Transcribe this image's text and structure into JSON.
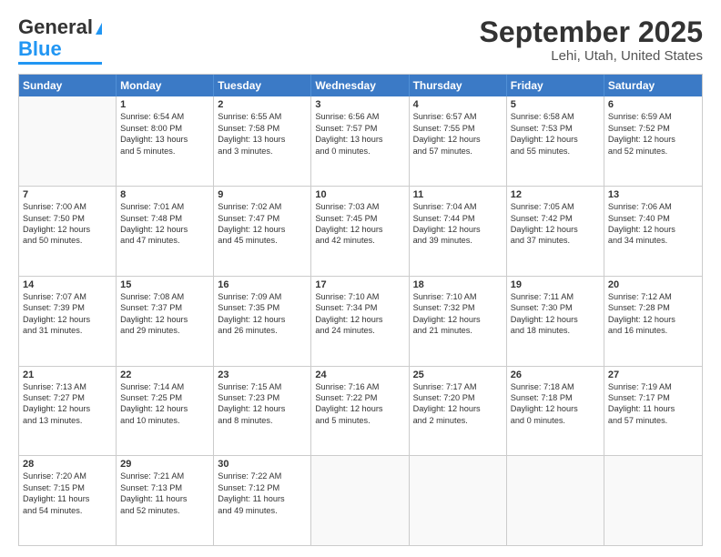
{
  "header": {
    "logo_line1": "General",
    "logo_line2": "Blue",
    "month": "September 2025",
    "location": "Lehi, Utah, United States"
  },
  "weekdays": [
    "Sunday",
    "Monday",
    "Tuesday",
    "Wednesday",
    "Thursday",
    "Friday",
    "Saturday"
  ],
  "rows": [
    [
      {
        "day": "",
        "lines": []
      },
      {
        "day": "1",
        "lines": [
          "Sunrise: 6:54 AM",
          "Sunset: 8:00 PM",
          "Daylight: 13 hours",
          "and 5 minutes."
        ]
      },
      {
        "day": "2",
        "lines": [
          "Sunrise: 6:55 AM",
          "Sunset: 7:58 PM",
          "Daylight: 13 hours",
          "and 3 minutes."
        ]
      },
      {
        "day": "3",
        "lines": [
          "Sunrise: 6:56 AM",
          "Sunset: 7:57 PM",
          "Daylight: 13 hours",
          "and 0 minutes."
        ]
      },
      {
        "day": "4",
        "lines": [
          "Sunrise: 6:57 AM",
          "Sunset: 7:55 PM",
          "Daylight: 12 hours",
          "and 57 minutes."
        ]
      },
      {
        "day": "5",
        "lines": [
          "Sunrise: 6:58 AM",
          "Sunset: 7:53 PM",
          "Daylight: 12 hours",
          "and 55 minutes."
        ]
      },
      {
        "day": "6",
        "lines": [
          "Sunrise: 6:59 AM",
          "Sunset: 7:52 PM",
          "Daylight: 12 hours",
          "and 52 minutes."
        ]
      }
    ],
    [
      {
        "day": "7",
        "lines": [
          "Sunrise: 7:00 AM",
          "Sunset: 7:50 PM",
          "Daylight: 12 hours",
          "and 50 minutes."
        ]
      },
      {
        "day": "8",
        "lines": [
          "Sunrise: 7:01 AM",
          "Sunset: 7:48 PM",
          "Daylight: 12 hours",
          "and 47 minutes."
        ]
      },
      {
        "day": "9",
        "lines": [
          "Sunrise: 7:02 AM",
          "Sunset: 7:47 PM",
          "Daylight: 12 hours",
          "and 45 minutes."
        ]
      },
      {
        "day": "10",
        "lines": [
          "Sunrise: 7:03 AM",
          "Sunset: 7:45 PM",
          "Daylight: 12 hours",
          "and 42 minutes."
        ]
      },
      {
        "day": "11",
        "lines": [
          "Sunrise: 7:04 AM",
          "Sunset: 7:44 PM",
          "Daylight: 12 hours",
          "and 39 minutes."
        ]
      },
      {
        "day": "12",
        "lines": [
          "Sunrise: 7:05 AM",
          "Sunset: 7:42 PM",
          "Daylight: 12 hours",
          "and 37 minutes."
        ]
      },
      {
        "day": "13",
        "lines": [
          "Sunrise: 7:06 AM",
          "Sunset: 7:40 PM",
          "Daylight: 12 hours",
          "and 34 minutes."
        ]
      }
    ],
    [
      {
        "day": "14",
        "lines": [
          "Sunrise: 7:07 AM",
          "Sunset: 7:39 PM",
          "Daylight: 12 hours",
          "and 31 minutes."
        ]
      },
      {
        "day": "15",
        "lines": [
          "Sunrise: 7:08 AM",
          "Sunset: 7:37 PM",
          "Daylight: 12 hours",
          "and 29 minutes."
        ]
      },
      {
        "day": "16",
        "lines": [
          "Sunrise: 7:09 AM",
          "Sunset: 7:35 PM",
          "Daylight: 12 hours",
          "and 26 minutes."
        ]
      },
      {
        "day": "17",
        "lines": [
          "Sunrise: 7:10 AM",
          "Sunset: 7:34 PM",
          "Daylight: 12 hours",
          "and 24 minutes."
        ]
      },
      {
        "day": "18",
        "lines": [
          "Sunrise: 7:10 AM",
          "Sunset: 7:32 PM",
          "Daylight: 12 hours",
          "and 21 minutes."
        ]
      },
      {
        "day": "19",
        "lines": [
          "Sunrise: 7:11 AM",
          "Sunset: 7:30 PM",
          "Daylight: 12 hours",
          "and 18 minutes."
        ]
      },
      {
        "day": "20",
        "lines": [
          "Sunrise: 7:12 AM",
          "Sunset: 7:28 PM",
          "Daylight: 12 hours",
          "and 16 minutes."
        ]
      }
    ],
    [
      {
        "day": "21",
        "lines": [
          "Sunrise: 7:13 AM",
          "Sunset: 7:27 PM",
          "Daylight: 12 hours",
          "and 13 minutes."
        ]
      },
      {
        "day": "22",
        "lines": [
          "Sunrise: 7:14 AM",
          "Sunset: 7:25 PM",
          "Daylight: 12 hours",
          "and 10 minutes."
        ]
      },
      {
        "day": "23",
        "lines": [
          "Sunrise: 7:15 AM",
          "Sunset: 7:23 PM",
          "Daylight: 12 hours",
          "and 8 minutes."
        ]
      },
      {
        "day": "24",
        "lines": [
          "Sunrise: 7:16 AM",
          "Sunset: 7:22 PM",
          "Daylight: 12 hours",
          "and 5 minutes."
        ]
      },
      {
        "day": "25",
        "lines": [
          "Sunrise: 7:17 AM",
          "Sunset: 7:20 PM",
          "Daylight: 12 hours",
          "and 2 minutes."
        ]
      },
      {
        "day": "26",
        "lines": [
          "Sunrise: 7:18 AM",
          "Sunset: 7:18 PM",
          "Daylight: 12 hours",
          "and 0 minutes."
        ]
      },
      {
        "day": "27",
        "lines": [
          "Sunrise: 7:19 AM",
          "Sunset: 7:17 PM",
          "Daylight: 11 hours",
          "and 57 minutes."
        ]
      }
    ],
    [
      {
        "day": "28",
        "lines": [
          "Sunrise: 7:20 AM",
          "Sunset: 7:15 PM",
          "Daylight: 11 hours",
          "and 54 minutes."
        ]
      },
      {
        "day": "29",
        "lines": [
          "Sunrise: 7:21 AM",
          "Sunset: 7:13 PM",
          "Daylight: 11 hours",
          "and 52 minutes."
        ]
      },
      {
        "day": "30",
        "lines": [
          "Sunrise: 7:22 AM",
          "Sunset: 7:12 PM",
          "Daylight: 11 hours",
          "and 49 minutes."
        ]
      },
      {
        "day": "",
        "lines": []
      },
      {
        "day": "",
        "lines": []
      },
      {
        "day": "",
        "lines": []
      },
      {
        "day": "",
        "lines": []
      }
    ]
  ]
}
